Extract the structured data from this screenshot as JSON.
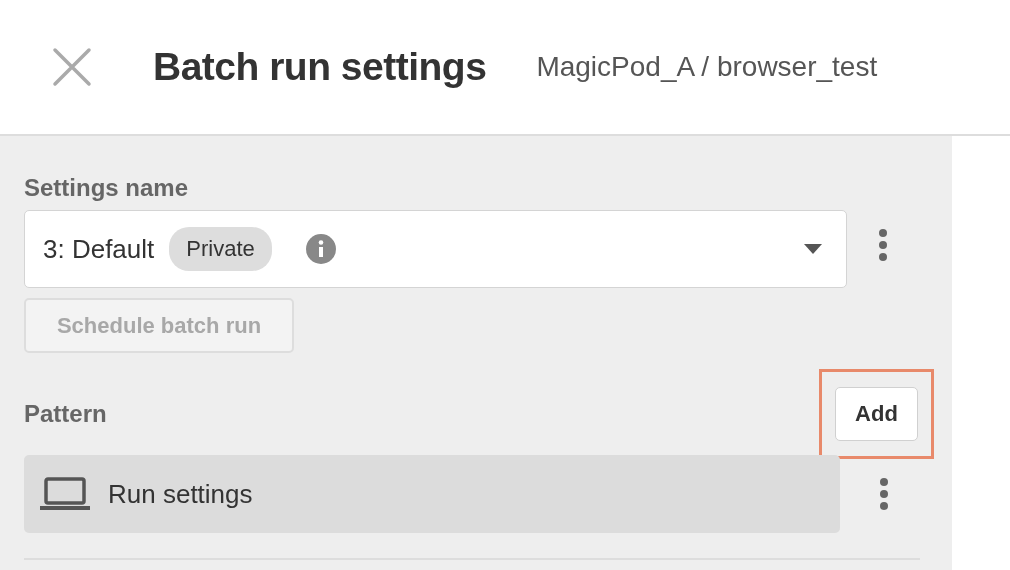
{
  "header": {
    "title": "Batch run settings",
    "breadcrumb": "MagicPod_A / browser_test"
  },
  "settings_name": {
    "label": "Settings name",
    "value": "3: Default",
    "badge": "Private"
  },
  "schedule_button": {
    "label": "Schedule batch run",
    "disabled": true
  },
  "pattern": {
    "label": "Pattern",
    "add_button": {
      "label": "Add",
      "highlighted": true
    },
    "items": [
      {
        "label": "Run settings"
      }
    ]
  }
}
